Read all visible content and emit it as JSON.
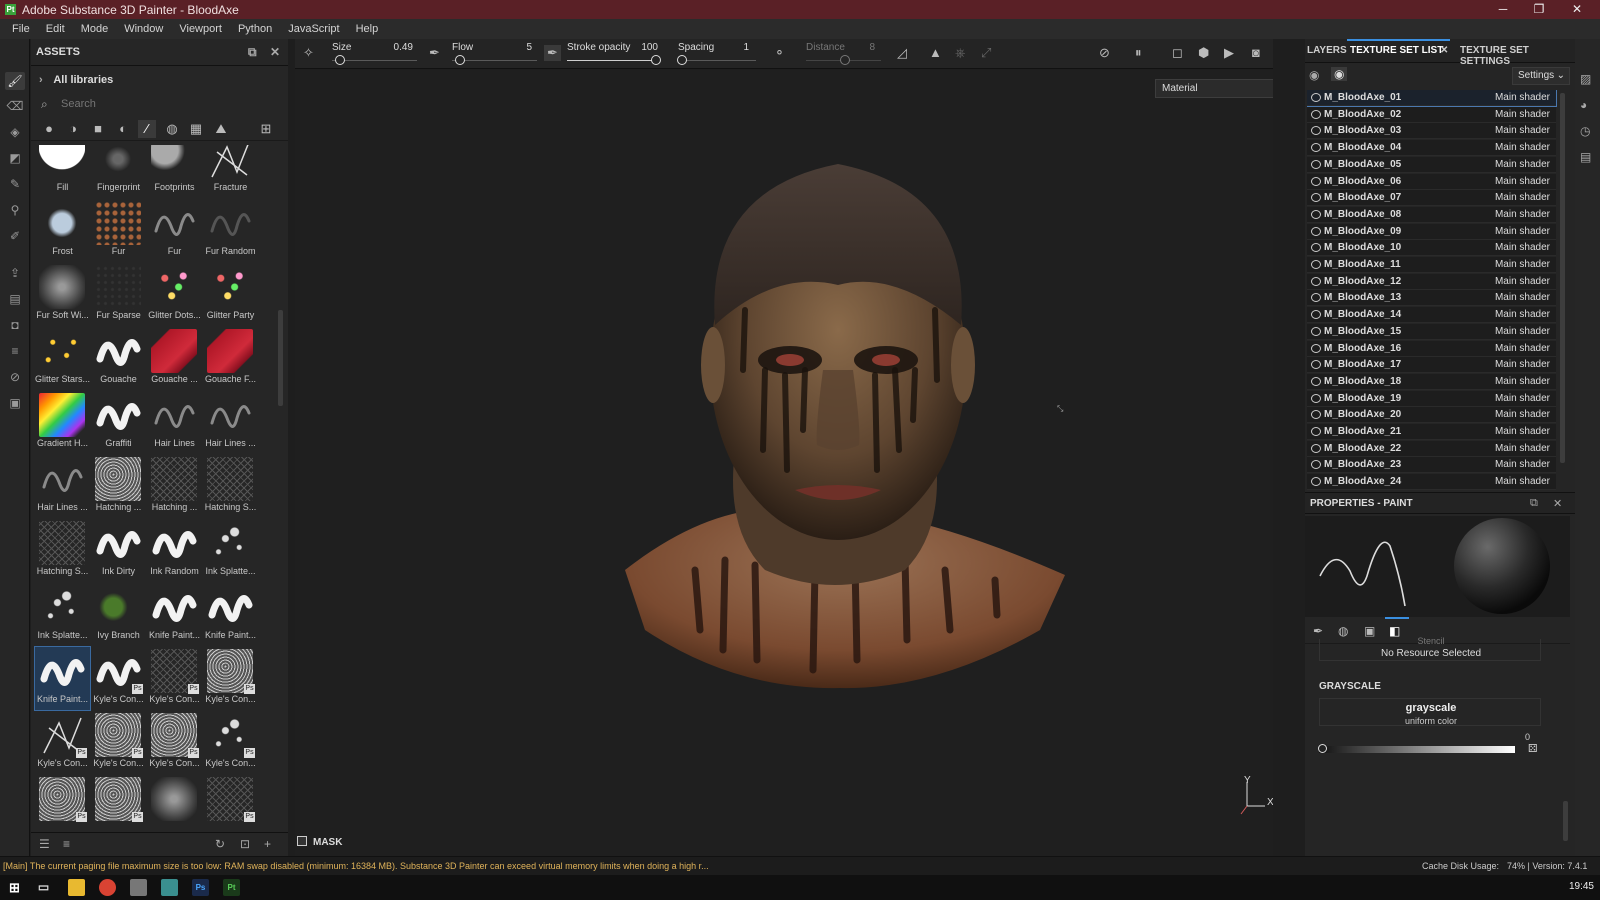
{
  "window": {
    "title": "Adobe Substance 3D Painter - BloodAxe",
    "app_badge": "Pt"
  },
  "menu": [
    "File",
    "Edit",
    "Mode",
    "Window",
    "Viewport",
    "Python",
    "JavaScript",
    "Help"
  ],
  "assets": {
    "title": "ASSETS",
    "libraries": "All libraries",
    "search_placeholder": "Search",
    "items": [
      {
        "label": "Fill",
        "kind": "fill"
      },
      {
        "label": "Fingerprint",
        "kind": "finger"
      },
      {
        "label": "Footprints",
        "kind": "foot"
      },
      {
        "label": "Fracture",
        "kind": "fracture"
      },
      {
        "label": "Frost",
        "kind": "frost"
      },
      {
        "label": "Fur",
        "kind": "furdots"
      },
      {
        "label": "Fur",
        "kind": "stroke-gray"
      },
      {
        "label": "Fur Random",
        "kind": "stroke-dark"
      },
      {
        "label": "Fur Soft Wi...",
        "kind": "soft"
      },
      {
        "label": "Fur Sparse",
        "kind": "sparse"
      },
      {
        "label": "Glitter Dots...",
        "kind": "glitter"
      },
      {
        "label": "Glitter Party",
        "kind": "glitter"
      },
      {
        "label": "Glitter Stars...",
        "kind": "stars"
      },
      {
        "label": "Gouache",
        "kind": "stroke-white"
      },
      {
        "label": "Gouache ...",
        "kind": "red"
      },
      {
        "label": "Gouache F...",
        "kind": "red"
      },
      {
        "label": "Gradient H...",
        "kind": "rainbow"
      },
      {
        "label": "Graffiti",
        "kind": "stroke-white"
      },
      {
        "label": "Hair Lines",
        "kind": "stroke-gray"
      },
      {
        "label": "Hair Lines ...",
        "kind": "stroke-gray"
      },
      {
        "label": "Hair Lines ...",
        "kind": "stroke-gray"
      },
      {
        "label": "Hatching ...",
        "kind": "noise"
      },
      {
        "label": "Hatching ...",
        "kind": "hatch"
      },
      {
        "label": "Hatching S...",
        "kind": "hatch"
      },
      {
        "label": "Hatching S...",
        "kind": "hatch"
      },
      {
        "label": "Ink Dirty",
        "kind": "stroke-white"
      },
      {
        "label": "Ink Random",
        "kind": "stroke-white"
      },
      {
        "label": "Ink Splatte...",
        "kind": "splat"
      },
      {
        "label": "Ink Splatte...",
        "kind": "splat"
      },
      {
        "label": "Ivy Branch",
        "kind": "ivy"
      },
      {
        "label": "Knife Paint...",
        "kind": "stroke-white"
      },
      {
        "label": "Knife Paint...",
        "kind": "stroke-white"
      },
      {
        "label": "Knife Paint...",
        "kind": "stroke-white"
      },
      {
        "label": "Kyle's Con...",
        "kind": "stroke-white"
      },
      {
        "label": "Kyle's Con...",
        "kind": "hatch"
      },
      {
        "label": "Kyle's Con...",
        "kind": "noise"
      },
      {
        "label": "Kyle's Con...",
        "kind": "scribble"
      },
      {
        "label": "Kyle's Con...",
        "kind": "noise"
      },
      {
        "label": "Kyle's Con...",
        "kind": "noise"
      },
      {
        "label": "Kyle's Con...",
        "kind": "splat"
      },
      {
        "label": "",
        "kind": "noise"
      },
      {
        "label": "",
        "kind": "noise"
      },
      {
        "label": "",
        "kind": "soft"
      },
      {
        "label": "",
        "kind": "hatch"
      }
    ],
    "selected_index": 32,
    "ps_badge": "Ps"
  },
  "toolbar": {
    "size_label": "Size",
    "size_value": "0.49",
    "flow_label": "Flow",
    "flow_value": "5",
    "opacity_label": "Stroke opacity",
    "opacity_value": "100",
    "spacing_label": "Spacing",
    "spacing_value": "1",
    "distance_label": "Distance",
    "distance_value": "8"
  },
  "viewport": {
    "material_mode": "Material",
    "axis_y": "Y",
    "axis_x": "X",
    "mask_label": "MASK"
  },
  "right_panel": {
    "tabs": [
      "LAYERS",
      "TEXTURE SET LIST",
      "TEXTURE SET SETTINGS"
    ],
    "active_tab": 1,
    "settings_label": "Settings",
    "texture_sets": [
      {
        "name": "M_BloodAxe_01",
        "shader": "Main shader"
      },
      {
        "name": "M_BloodAxe_02",
        "shader": "Main shader"
      },
      {
        "name": "M_BloodAxe_03",
        "shader": "Main shader"
      },
      {
        "name": "M_BloodAxe_04",
        "shader": "Main shader"
      },
      {
        "name": "M_BloodAxe_05",
        "shader": "Main shader"
      },
      {
        "name": "M_BloodAxe_06",
        "shader": "Main shader"
      },
      {
        "name": "M_BloodAxe_07",
        "shader": "Main shader"
      },
      {
        "name": "M_BloodAxe_08",
        "shader": "Main shader"
      },
      {
        "name": "M_BloodAxe_09",
        "shader": "Main shader"
      },
      {
        "name": "M_BloodAxe_10",
        "shader": "Main shader"
      },
      {
        "name": "M_BloodAxe_11",
        "shader": "Main shader"
      },
      {
        "name": "M_BloodAxe_12",
        "shader": "Main shader"
      },
      {
        "name": "M_BloodAxe_13",
        "shader": "Main shader"
      },
      {
        "name": "M_BloodAxe_14",
        "shader": "Main shader"
      },
      {
        "name": "M_BloodAxe_15",
        "shader": "Main shader"
      },
      {
        "name": "M_BloodAxe_16",
        "shader": "Main shader"
      },
      {
        "name": "M_BloodAxe_17",
        "shader": "Main shader"
      },
      {
        "name": "M_BloodAxe_18",
        "shader": "Main shader"
      },
      {
        "name": "M_BloodAxe_19",
        "shader": "Main shader"
      },
      {
        "name": "M_BloodAxe_20",
        "shader": "Main shader"
      },
      {
        "name": "M_BloodAxe_21",
        "shader": "Main shader"
      },
      {
        "name": "M_BloodAxe_22",
        "shader": "Main shader"
      },
      {
        "name": "M_BloodAxe_23",
        "shader": "Main shader"
      },
      {
        "name": "M_BloodAxe_24",
        "shader": "Main shader"
      }
    ],
    "selected_set": 0
  },
  "properties": {
    "title": "PROPERTIES - PAINT",
    "stencil_label": "Stencil",
    "no_resource": "No Resource Selected",
    "grayscale_title": "GRAYSCALE",
    "grayscale_name": "grayscale",
    "grayscale_sub": "uniform color",
    "grayscale_value": "0"
  },
  "status": {
    "message": "[Main] The current paging file maximum size is too low: RAM swap disabled (minimum: 16384 MB). Substance 3D Painter can exceed virtual memory limits when doing a high r...",
    "cache": "Cache Disk Usage:",
    "version": "74% | Version: 7.4.1"
  },
  "taskbar": {
    "clock": "19:45"
  },
  "colors": {
    "titlebar": "#5a2026",
    "accent": "#3a8fe0",
    "warning": "#e0b35a"
  }
}
